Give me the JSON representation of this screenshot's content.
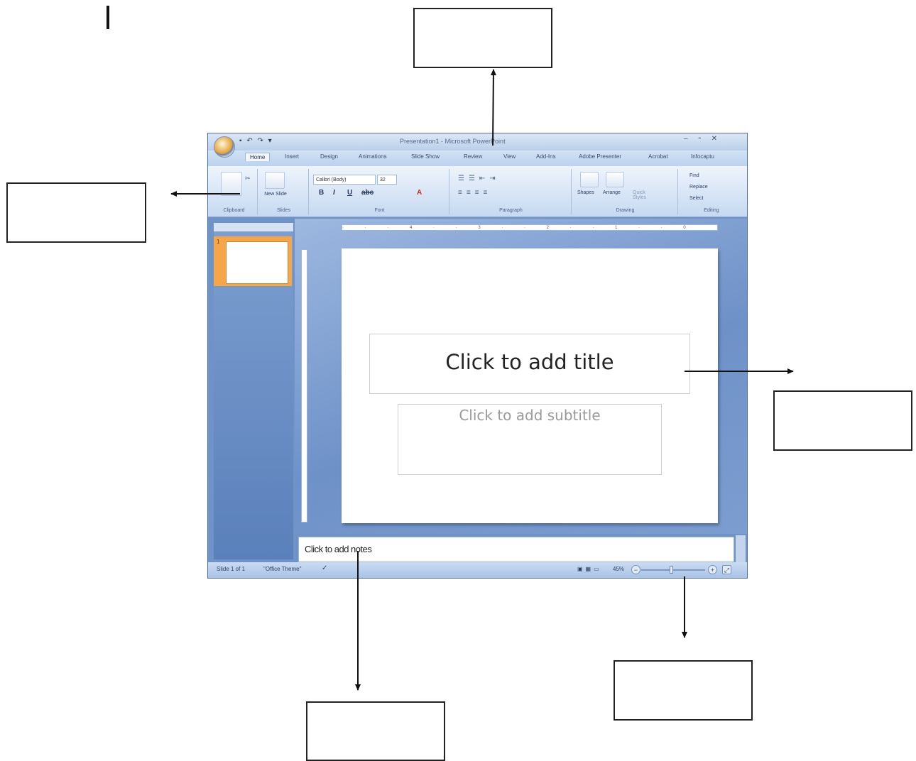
{
  "window": {
    "title": "Presentation1 - Microsoft PowerPoint",
    "quick_access": "▪ ↶ ↷ ▾",
    "controls": "– ▫ ✕"
  },
  "ribbon": {
    "tabs": [
      "Home",
      "Insert",
      "Design",
      "Animations",
      "Slide Show",
      "Review",
      "View",
      "Add-Ins",
      "Adobe Presenter",
      "Acrobat",
      "Infocaptu"
    ],
    "groups": {
      "clipboard": "Clipboard",
      "slides": "Slides",
      "font": "Font",
      "paragraph": "Paragraph",
      "drawing": "Drawing",
      "editing": "Editing"
    },
    "font_name": "Calibri (Body)",
    "font_size": "32",
    "new_slide": "New Slide",
    "shapes": "Shapes",
    "arrange": "Arrange",
    "quick_styles": "Quick Styles",
    "find": "Find",
    "replace": "Replace",
    "select": "Select"
  },
  "slides_pane": {
    "thumb_number": "1"
  },
  "slide": {
    "title_placeholder": "Click to add title",
    "subtitle_placeholder": "Click to add subtitle"
  },
  "notes": {
    "placeholder": "Click to add notes"
  },
  "status": {
    "slide_counter": "Slide 1 of 1",
    "theme": "\"Office Theme\"",
    "zoom": "45%"
  }
}
